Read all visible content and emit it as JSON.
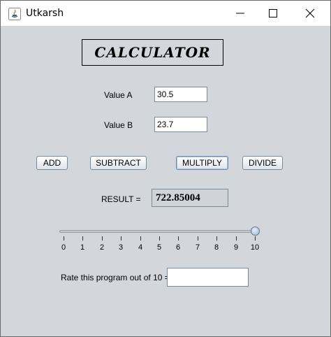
{
  "window": {
    "title": "Utkarsh",
    "app_icon": "java-icon",
    "controls": [
      "minimize-icon",
      "maximize-icon",
      "close-icon"
    ]
  },
  "heading": "CALCULATOR",
  "inputs": {
    "a_label": "Value A",
    "a_value": "30.5",
    "b_label": "Value B",
    "b_value": "23.7"
  },
  "buttons": {
    "add": "ADD",
    "subtract": "SUBTRACT",
    "multiply": "MULTIPLY",
    "divide": "DIVIDE"
  },
  "result": {
    "label": "RESULT =",
    "value": "722.85004"
  },
  "slider": {
    "min": 0,
    "max": 10,
    "value": 10,
    "ticks": [
      "0",
      "1",
      "2",
      "3",
      "4",
      "5",
      "6",
      "7",
      "8",
      "9",
      "10"
    ]
  },
  "rating": {
    "label": "Rate this program out of 10 =",
    "value": ""
  },
  "colors": {
    "client_bg": "#d3d6db",
    "focus_border": "#6e8bab"
  }
}
